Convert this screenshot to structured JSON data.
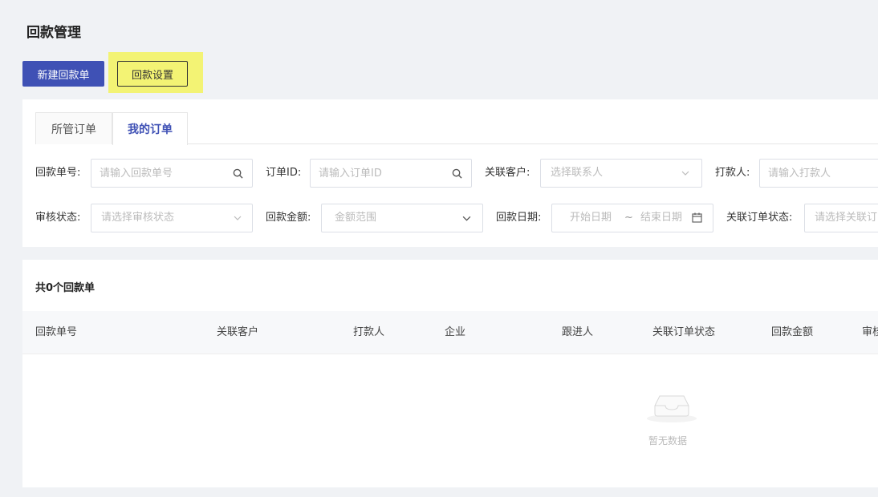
{
  "page": {
    "title": "回款管理"
  },
  "actions": {
    "new_label": "新建回款单",
    "settings_label": "回款设置"
  },
  "tabs": [
    {
      "label": "所管订单",
      "active": false
    },
    {
      "label": "我的订单",
      "active": true
    }
  ],
  "filters": {
    "receipt_no": {
      "label": "回款单号:",
      "placeholder": "请输入回款单号"
    },
    "order_id": {
      "label": "订单ID:",
      "placeholder": "请输入订单ID"
    },
    "customer": {
      "label": "关联客户:",
      "placeholder": "选择联系人"
    },
    "payer": {
      "label": "打款人:",
      "placeholder": "请输入打款人"
    },
    "review_status": {
      "label": "审核状态:",
      "placeholder": "请选择审核状态"
    },
    "amount": {
      "label": "回款金额:",
      "placeholder": "金额范围"
    },
    "date": {
      "label": "回款日期:",
      "start_placeholder": "开始日期",
      "separator": "~",
      "end_placeholder": "结束日期"
    },
    "order_status": {
      "label": "关联订单状态:",
      "placeholder": "请选择关联订"
    }
  },
  "list": {
    "count_text": "共0个回款单",
    "columns": [
      "回款单号",
      "关联客户",
      "打款人",
      "企业",
      "跟进人",
      "关联订单状态",
      "回款金额",
      "审核"
    ],
    "empty_text": "暂无数据"
  },
  "colors": {
    "primary": "#3f51b5",
    "highlight": "#f3f374"
  }
}
